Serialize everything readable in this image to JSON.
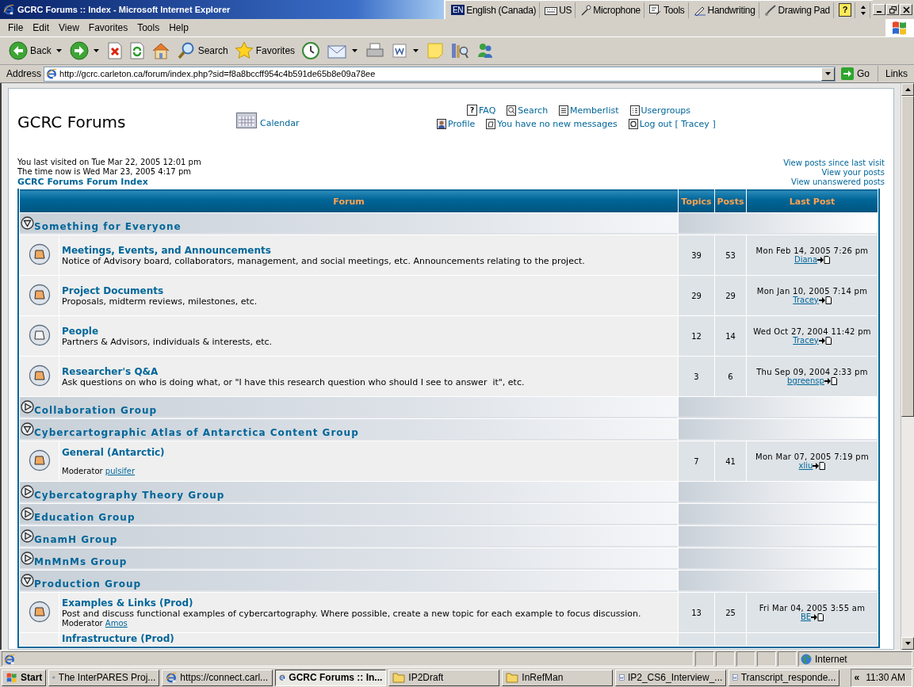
{
  "window": {
    "title": "GCRC Forums :: Index - Microsoft Internet Explorer"
  },
  "language_bar": [
    {
      "kind": "lang",
      "badge": "EN",
      "label": "English (Canada)"
    },
    {
      "kind": "keyboard",
      "label": "US"
    },
    {
      "kind": "mic",
      "label": "Microphone"
    },
    {
      "kind": "tools",
      "label": "Tools"
    },
    {
      "kind": "pen",
      "label": "Handwriting"
    },
    {
      "kind": "pad",
      "label": "Drawing Pad"
    },
    {
      "kind": "help",
      "glyph": "?"
    },
    {
      "kind": "options"
    }
  ],
  "menu": [
    "File",
    "Edit",
    "View",
    "Favorites",
    "Tools",
    "Help"
  ],
  "toolbar": [
    {
      "kind": "back",
      "label": "Back",
      "dropdown": true
    },
    {
      "kind": "forward",
      "dropdown": true
    },
    {
      "kind": "stop"
    },
    {
      "kind": "refresh"
    },
    {
      "kind": "home"
    },
    {
      "kind": "search",
      "label": "Search"
    },
    {
      "kind": "favorites",
      "label": "Favorites"
    },
    {
      "kind": "history"
    },
    {
      "kind": "mail",
      "dropdown": true
    },
    {
      "kind": "print"
    },
    {
      "kind": "edit",
      "dropdown": true
    },
    {
      "kind": "note"
    },
    {
      "kind": "research"
    },
    {
      "kind": "messenger"
    }
  ],
  "address": {
    "label": "Address",
    "value": "http://gcrc.carleton.ca/forum/index.php?sid=f8a8bccff954c4b591de65b8e09a78ee",
    "go": "Go",
    "links": "Links"
  },
  "page": {
    "title": "GCRC Forums",
    "calendar": "Calendar",
    "nav_rows": [
      [
        {
          "kind": "faq",
          "glyph": "?",
          "label": "FAQ"
        },
        {
          "kind": "search",
          "label": "Search"
        },
        {
          "kind": "memberlist",
          "label": "Memberlist"
        },
        {
          "kind": "usergroups",
          "label": "Usergroups"
        }
      ],
      [
        {
          "kind": "profile",
          "label": "Profile"
        },
        {
          "kind": "messages",
          "label": "You have no new messages"
        },
        {
          "kind": "logout",
          "label": "Log out [ Tracey ]"
        }
      ]
    ],
    "last_visit": "You last visited on Tue Mar 22, 2005 12:01 pm",
    "time_now": "The time now is Wed Mar 23, 2005 4:17 pm",
    "index_link": "GCRC Forums Forum Index",
    "view_links": [
      "View posts since last visit",
      "View your posts",
      "View unanswered posts"
    ]
  },
  "table": {
    "columns": [
      "Forum",
      "Topics",
      "Posts",
      "Last Post"
    ],
    "categories": [
      {
        "name": "Something for Everyone",
        "expanded": true,
        "forums": [
          {
            "name": "Meetings, Events, and Announcements",
            "description": "Notice of Advisory board, collaborators, management, and social meetings, etc. Announcements relating to the project.",
            "new_posts": true,
            "topics": "39",
            "posts": "53",
            "last_date": "Mon Feb 14, 2005 7:26 pm",
            "last_user": "Diana"
          },
          {
            "name": "Project Documents",
            "description": "Proposals, midterm reviews, milestones, etc.",
            "new_posts": true,
            "topics": "29",
            "posts": "29",
            "last_date": "Mon Jan 10, 2005 7:14 pm",
            "last_user": "Tracey"
          },
          {
            "name": "People",
            "description": "Partners & Advisors, individuals & interests, etc.",
            "new_posts": false,
            "topics": "12",
            "posts": "14",
            "last_date": "Wed Oct 27, 2004 11:42 pm",
            "last_user": "Tracey"
          },
          {
            "name": "Researcher's Q&A",
            "description": "Ask questions on who is doing what, or \"I have this research question who should I see to answer  it\", etc.",
            "new_posts": true,
            "topics": "3",
            "posts": "6",
            "last_date": "Thu Sep 09, 2004 2:33 pm",
            "last_user": "bgreensp"
          }
        ]
      },
      {
        "name": "Collaboration Group",
        "expanded": false
      },
      {
        "name": "Cybercartographic Atlas of Antarctica Content Group",
        "expanded": true,
        "forums": [
          {
            "name": "General (Antarctic)",
            "moderator_label": "Moderator",
            "moderator": "pulsifer",
            "new_posts": true,
            "topics": "7",
            "posts": "41",
            "last_date": "Mon Mar 07, 2005 7:19 pm",
            "last_user": "xliu"
          }
        ]
      },
      {
        "name": "Cybercatography Theory Group",
        "expanded": false
      },
      {
        "name": "Education Group",
        "expanded": false
      },
      {
        "name": "GnamH Group",
        "expanded": false
      },
      {
        "name": "MnMnMs Group",
        "expanded": false
      },
      {
        "name": "Production Group",
        "expanded": true,
        "forums": [
          {
            "name": "Examples & Links (Prod)",
            "description": "Post and discuss functional examples of cybercartography. Where possible, create a new topic for each example to focus discussion.",
            "moderator_label": "Moderator",
            "moderator": "Amos",
            "new_posts": true,
            "topics": "13",
            "posts": "25",
            "last_date": "Fri Mar 04, 2005 3:55 am",
            "last_user": "BE"
          },
          {
            "name": "Infrastructure (Prod)"
          }
        ]
      }
    ]
  },
  "status_bar": {
    "zone": "Internet"
  },
  "taskbar": {
    "start": "Start",
    "tasks": [
      {
        "kind": "ie",
        "label": "The InterPARES Proj...",
        "selected": false
      },
      {
        "kind": "ie",
        "label": "https://connect.carl...",
        "selected": false
      },
      {
        "kind": "ie",
        "label": "GCRC Forums :: In...",
        "selected": true
      },
      {
        "kind": "folder",
        "label": "IP2Draft",
        "selected": false
      },
      {
        "kind": "folder",
        "label": "InRefMan",
        "selected": false
      },
      {
        "kind": "word",
        "label": "IP2_CS6_Interview_...",
        "selected": false
      },
      {
        "kind": "word",
        "label": "Transcript_responde...",
        "selected": false
      }
    ],
    "expand": "«",
    "time": "11:30 AM"
  }
}
